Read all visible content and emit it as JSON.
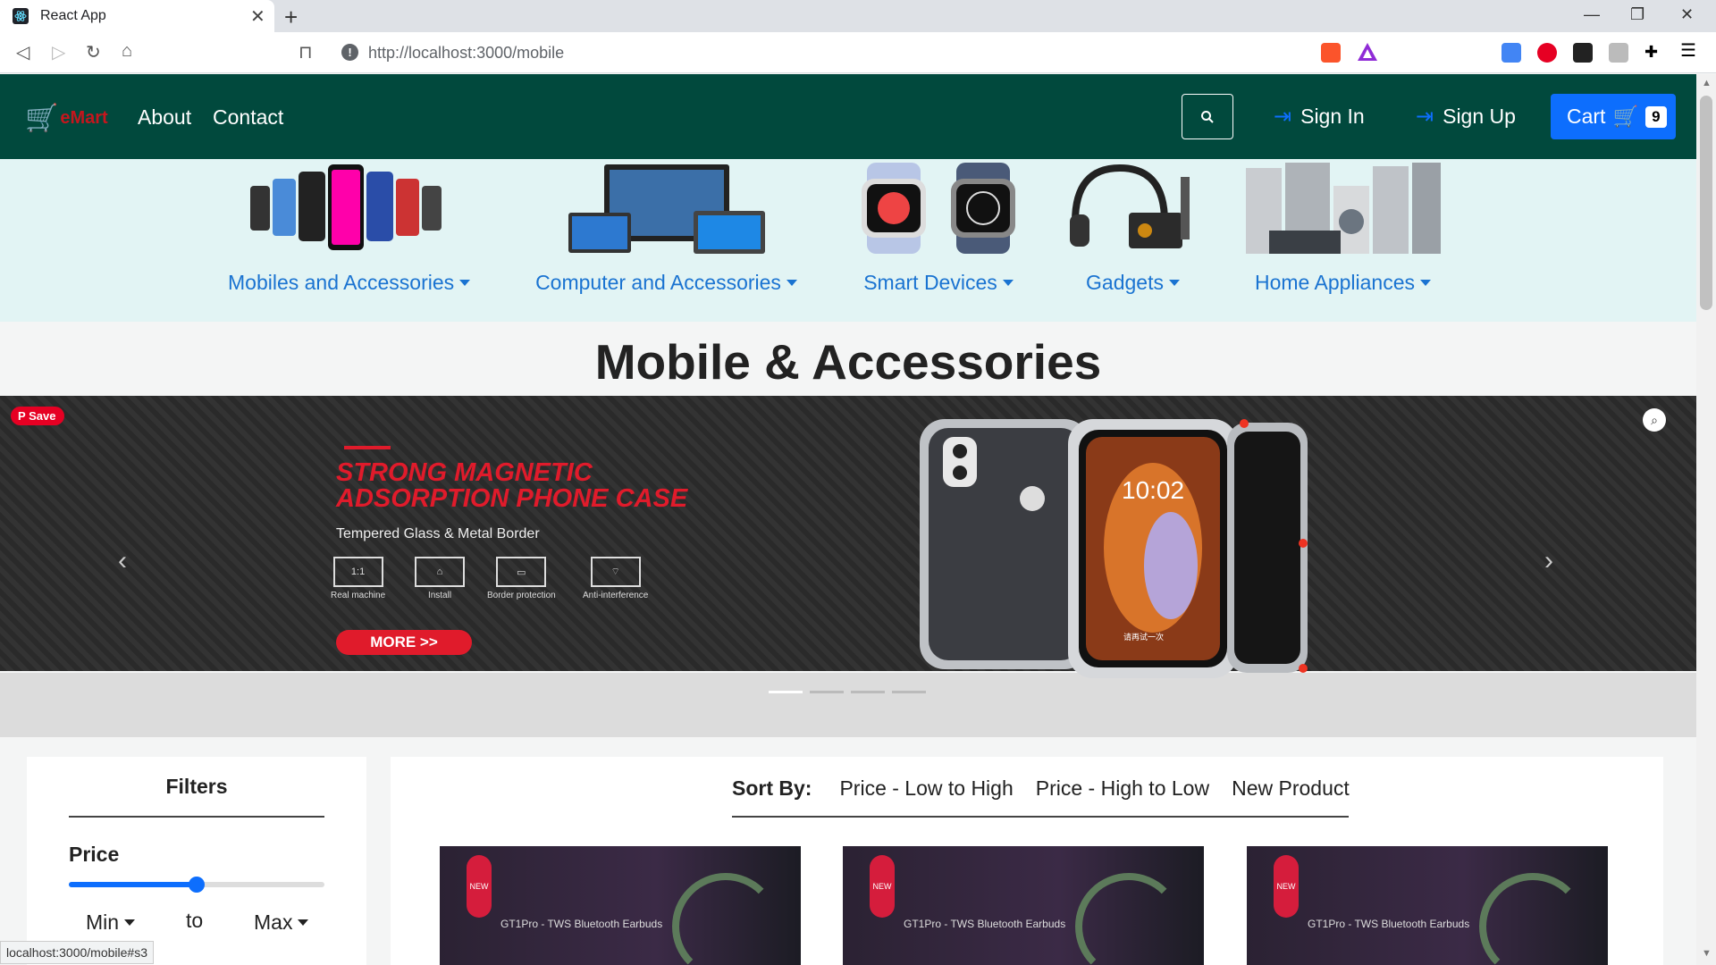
{
  "browser": {
    "tab_title": "React App",
    "url": "http://localhost:3000/mobile",
    "status_url": "localhost:3000/mobile#s3"
  },
  "navbar": {
    "brand": "eMart",
    "links": [
      "About",
      "Contact"
    ],
    "sign_in": "Sign In",
    "sign_up": "Sign Up",
    "cart_label": "Cart",
    "cart_count": "9"
  },
  "categories": [
    {
      "label": "Mobiles and Accessories",
      "icon": "phones-image"
    },
    {
      "label": "Computer and Accessories",
      "icon": "computers-image"
    },
    {
      "label": "Smart Devices",
      "icon": "smartwatch-image"
    },
    {
      "label": "Gadgets",
      "icon": "headphones-image"
    },
    {
      "label": "Home Appliances",
      "icon": "appliances-image"
    }
  ],
  "heading": "Mobile & Accessories",
  "banner": {
    "pin_save": "Save",
    "title_line1": "STRONG MAGNETIC",
    "title_line2": "ADSORPTION PHONE CASE",
    "subtitle": "Tempered Glass & Metal Border",
    "features": [
      {
        "icon": "1:1",
        "caption": "Real machine"
      },
      {
        "icon": "",
        "caption": "Install"
      },
      {
        "icon": "",
        "caption": "Border protection"
      },
      {
        "icon": "",
        "caption": "Anti-interference"
      }
    ],
    "more_button": "MORE >>",
    "phone_time": "10:02",
    "phone_bottom_text": "请再试一次"
  },
  "filters": {
    "title": "Filters",
    "price_label": "Price",
    "price_slider_fraction": 0.5,
    "min_label": "Min",
    "to_label": "to",
    "max_label": "Max"
  },
  "sort": {
    "label": "Sort By:",
    "options": [
      "Price - Low to High",
      "Price - High to Low",
      "New Product"
    ]
  },
  "products": [
    {
      "badge": "NEW",
      "name": "GT1Pro - TWS Bluetooth Earbuds"
    },
    {
      "badge": "NEW",
      "name": "GT1Pro - TWS Bluetooth Earbuds"
    },
    {
      "badge": "NEW",
      "name": "GT1Pro - TWS Bluetooth Earbuds"
    }
  ],
  "colors": {
    "navbar": "#01493d",
    "accent": "#0d6efd",
    "brand_red": "#c5161d",
    "category_bg": "#e2f4f4"
  }
}
